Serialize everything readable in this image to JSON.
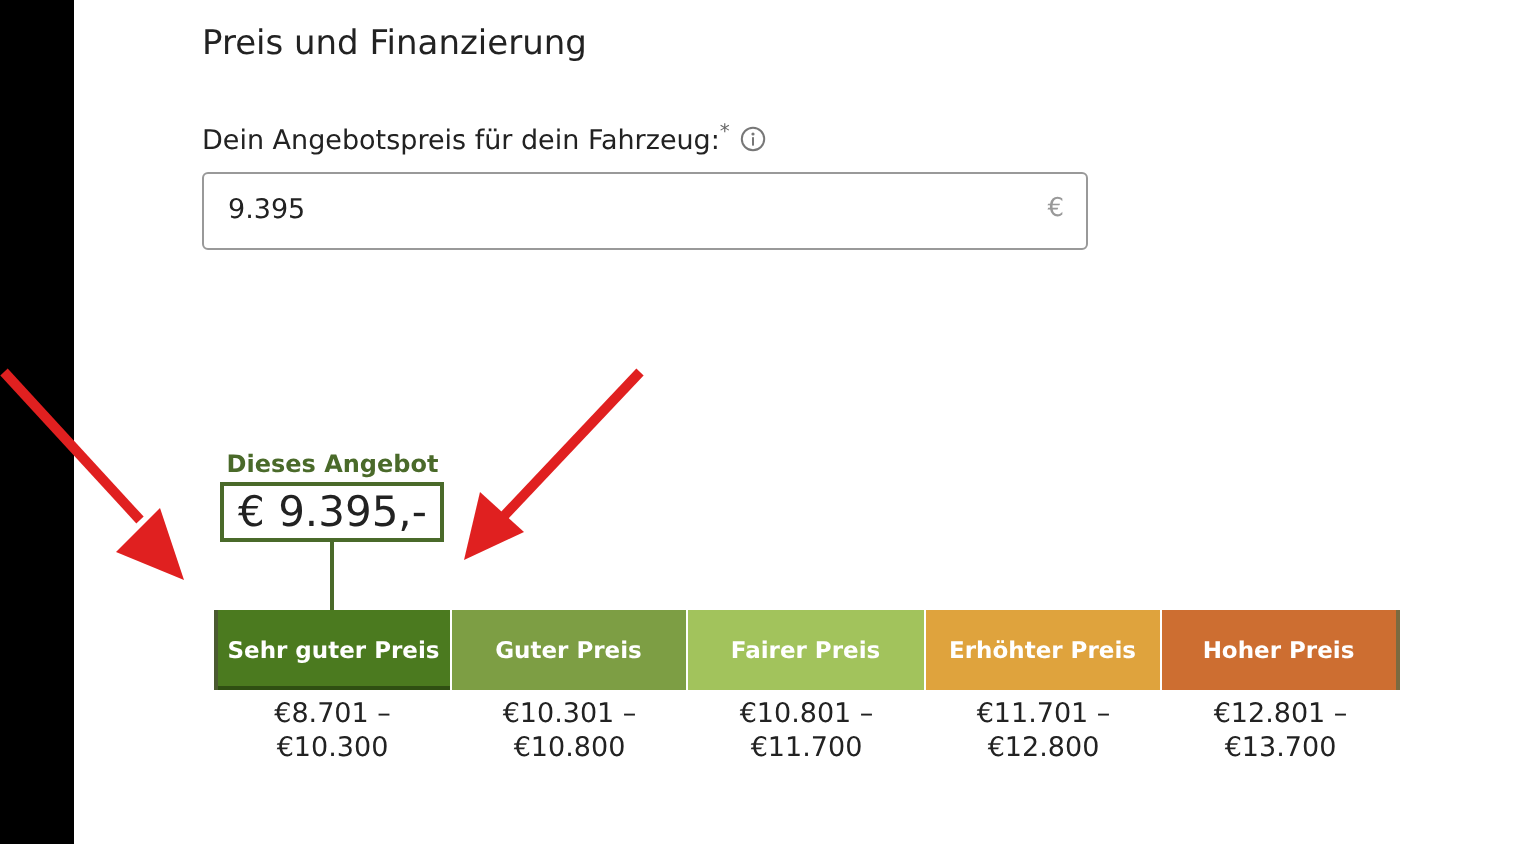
{
  "section_title": "Preis und Finanzierung",
  "price_field": {
    "label": "Dein Angebotspreis für dein Fahrzeug:",
    "required_mark": "*",
    "value": "9.395",
    "unit": "€"
  },
  "offer_marker": {
    "label": "Dieses Angebot",
    "price": "€ 9.395,-"
  },
  "price_ranges": [
    {
      "label": "Sehr guter Preis",
      "range": "€8.701 – €10.300",
      "color": "#4b7a1f",
      "selected": true
    },
    {
      "label": "Guter Preis",
      "range": "€10.301 – €10.800",
      "color": "#7d9e44",
      "selected": false
    },
    {
      "label": "Fairer Preis",
      "range": "€10.801 – €11.700",
      "color": "#a2c35c",
      "selected": false
    },
    {
      "label": "Erhöhter Preis",
      "range": "€11.701 – €12.800",
      "color": "#dfa33d",
      "selected": false
    },
    {
      "label": "Hoher Preis",
      "range": "€12.801 – €13.700",
      "color": "#cd6e31",
      "selected": false
    }
  ]
}
